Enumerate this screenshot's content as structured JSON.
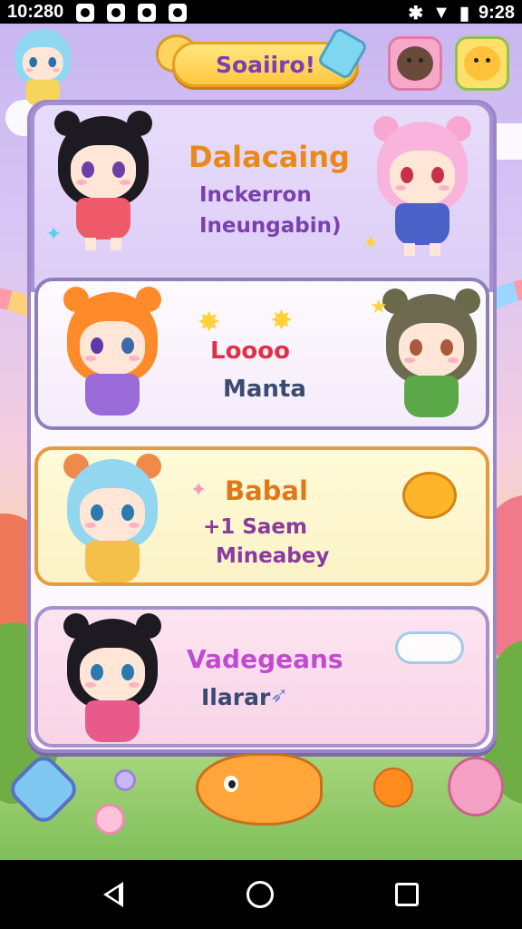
{
  "status_bar": {
    "time_left": "10:280",
    "time_right": "9:28"
  },
  "header": {
    "title": "Soaiiro!"
  },
  "cards": [
    {
      "title": "Dalacaing",
      "lines": [
        "Inckerron",
        "Ineungabin)"
      ]
    },
    {
      "title": "Loooo",
      "lines": [
        "Manta"
      ]
    },
    {
      "title": "Babal",
      "lines": [
        "+1 Saem",
        "Mineabey"
      ]
    },
    {
      "title": "Vadegeans",
      "lines": [
        "Ilarar"
      ]
    }
  ],
  "colors": {
    "title_text": "#7a3fb0",
    "card0_title": "#e88a1a",
    "card0_text": "#7a3fb0",
    "card1_title": "#e0304a",
    "card1_text": "#3a4a70",
    "card2_title": "#e0781a",
    "card2_text": "#8a3aa0",
    "card3_title": "#c04ad0",
    "card3_text": "#3a4a70"
  },
  "icons": {
    "bear_button": "bear-face-icon",
    "cat_button": "cat-face-icon",
    "back_button": "back-arrow-icon"
  }
}
